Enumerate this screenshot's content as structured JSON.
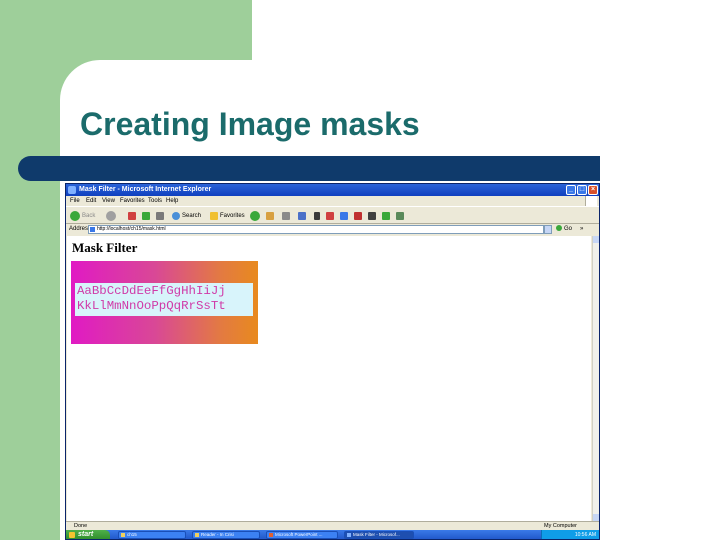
{
  "slide": {
    "title": "Creating Image masks"
  },
  "browser": {
    "window_title": "Mask Filter - Microsoft Internet Explorer",
    "menu": [
      "File",
      "Edit",
      "View",
      "Favorites",
      "Tools",
      "Help"
    ],
    "toolbar": {
      "back_label": "Back",
      "search_label": "Search",
      "favorites_label": "Favorites"
    },
    "address": {
      "label": "Address",
      "value": "http://localhost/ch15/mask.html",
      "go_label": "Go",
      "links_label": "»"
    },
    "status": {
      "left": "Done",
      "zone": "My Computer"
    }
  },
  "page": {
    "heading": "Mask Filter",
    "mask_line1": "AaBbCcDdEeFfGgHhIiJj",
    "mask_line2": "KkLlMmNnOoPpQqRrSsTt"
  },
  "taskbar": {
    "start_label": "start",
    "items": [
      {
        "label": "ch15"
      },
      {
        "label": "Reader - In Crisi"
      },
      {
        "label": "Microsoft PowerPoint ..."
      },
      {
        "label": "Mask Filter - Microsof..."
      }
    ],
    "clock": "10:56 AM"
  },
  "colors": {
    "slide_title": "#1b6b6b",
    "title_bar": "#0f3a6b",
    "green": "#9ecf9a",
    "gradient_start": "#e01ac4",
    "gradient_end": "#e88a1e"
  }
}
